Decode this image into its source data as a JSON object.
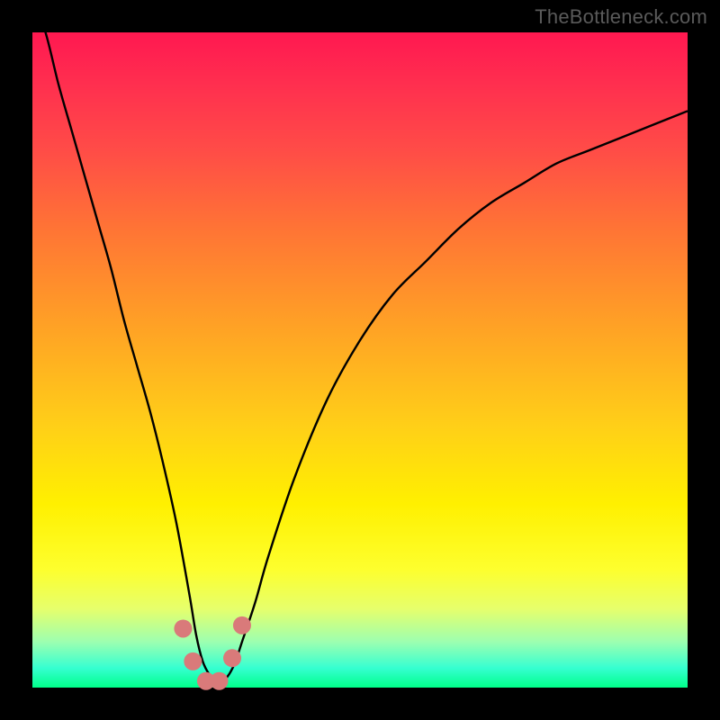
{
  "watermark": {
    "text": "TheBottleneck.com"
  },
  "chart_data": {
    "type": "line",
    "title": "",
    "xlabel": "",
    "ylabel": "",
    "xlim": [
      0,
      100
    ],
    "ylim": [
      0,
      100
    ],
    "grid": false,
    "legend": false,
    "series": [
      {
        "name": "bottleneck-curve",
        "x": [
          0,
          2,
          4,
          6,
          8,
          10,
          12,
          14,
          16,
          18,
          20,
          22,
          24,
          25,
          26,
          27,
          28,
          29,
          30,
          31,
          32,
          34,
          36,
          40,
          45,
          50,
          55,
          60,
          65,
          70,
          75,
          80,
          85,
          90,
          95,
          100
        ],
        "y": [
          105,
          100,
          92,
          85,
          78,
          71,
          64,
          56,
          49,
          42,
          34,
          25,
          14,
          8,
          4,
          2,
          1,
          1,
          2,
          4,
          7,
          13,
          20,
          32,
          44,
          53,
          60,
          65,
          70,
          74,
          77,
          80,
          82,
          84,
          86,
          88
        ]
      }
    ],
    "markers": [
      {
        "name": "curve-marker",
        "x": 23.0,
        "y": 9.0
      },
      {
        "name": "curve-marker",
        "x": 24.5,
        "y": 4.0
      },
      {
        "name": "curve-marker",
        "x": 26.5,
        "y": 1.0
      },
      {
        "name": "curve-marker",
        "x": 28.5,
        "y": 1.0
      },
      {
        "name": "curve-marker",
        "x": 30.5,
        "y": 4.5
      },
      {
        "name": "curve-marker",
        "x": 32.0,
        "y": 9.5
      }
    ],
    "colors": {
      "curve_stroke": "#000000",
      "marker_fill": "#d97a7a",
      "gradient_top": "#ff1850",
      "gradient_bottom": "#00ff8a",
      "frame": "#000000"
    }
  }
}
